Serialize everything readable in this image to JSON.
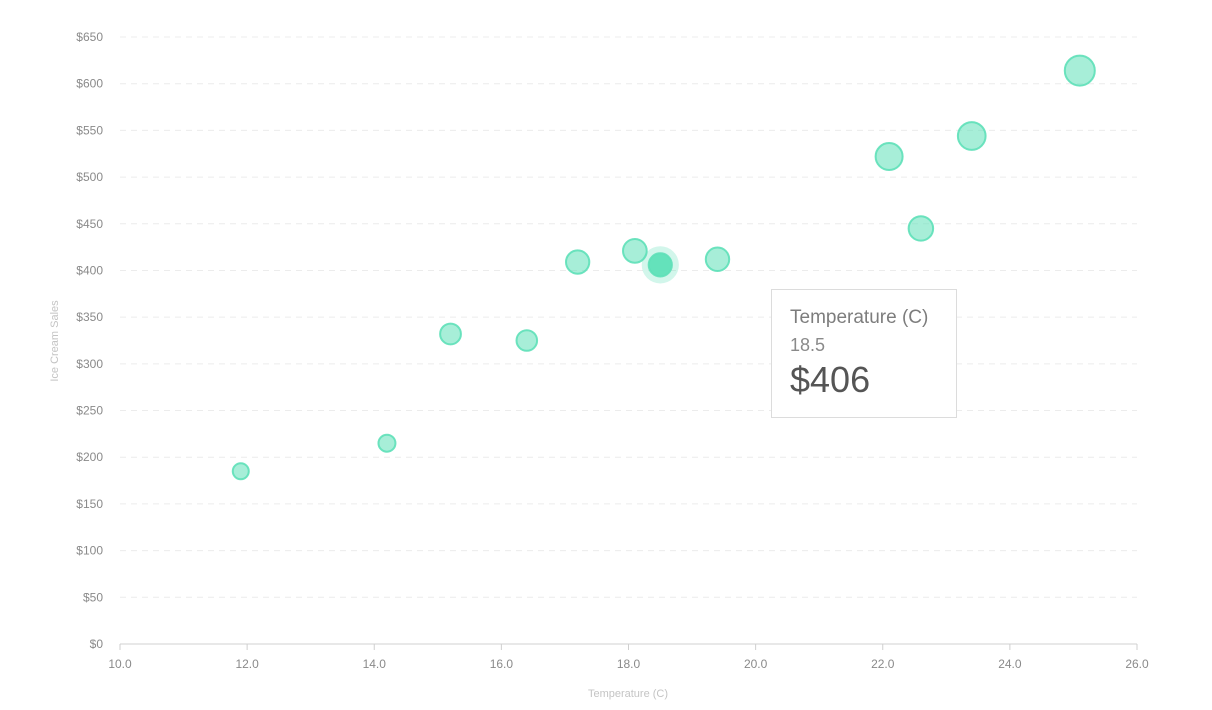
{
  "chart_data": {
    "type": "scatter",
    "title": "",
    "xlabel": "Temperature (C)",
    "ylabel": "Ice Cream Sales",
    "xlim": [
      10,
      26
    ],
    "ylim": [
      0,
      650
    ],
    "x_ticks": [
      "10.0",
      "12.0",
      "14.0",
      "16.0",
      "18.0",
      "20.0",
      "22.0",
      "24.0",
      "26.0"
    ],
    "y_ticks": [
      "$0",
      "$50",
      "$100",
      "$150",
      "$200",
      "$250",
      "$300",
      "$350",
      "$400",
      "$450",
      "$500",
      "$550",
      "$600",
      "$650"
    ],
    "grid": true,
    "color": "#5ee0b8",
    "points": [
      {
        "x": 11.9,
        "y": 185
      },
      {
        "x": 14.2,
        "y": 215
      },
      {
        "x": 15.2,
        "y": 332
      },
      {
        "x": 16.4,
        "y": 325
      },
      {
        "x": 17.2,
        "y": 409
      },
      {
        "x": 18.1,
        "y": 421
      },
      {
        "x": 18.5,
        "y": 406
      },
      {
        "x": 19.4,
        "y": 412
      },
      {
        "x": 22.1,
        "y": 522
      },
      {
        "x": 22.6,
        "y": 445
      },
      {
        "x": 23.4,
        "y": 544
      },
      {
        "x": 25.1,
        "y": 614
      }
    ],
    "highlighted_index": 6
  },
  "tooltip": {
    "title": "Temperature (C)",
    "x_value": "18.5",
    "y_value": "$406"
  }
}
